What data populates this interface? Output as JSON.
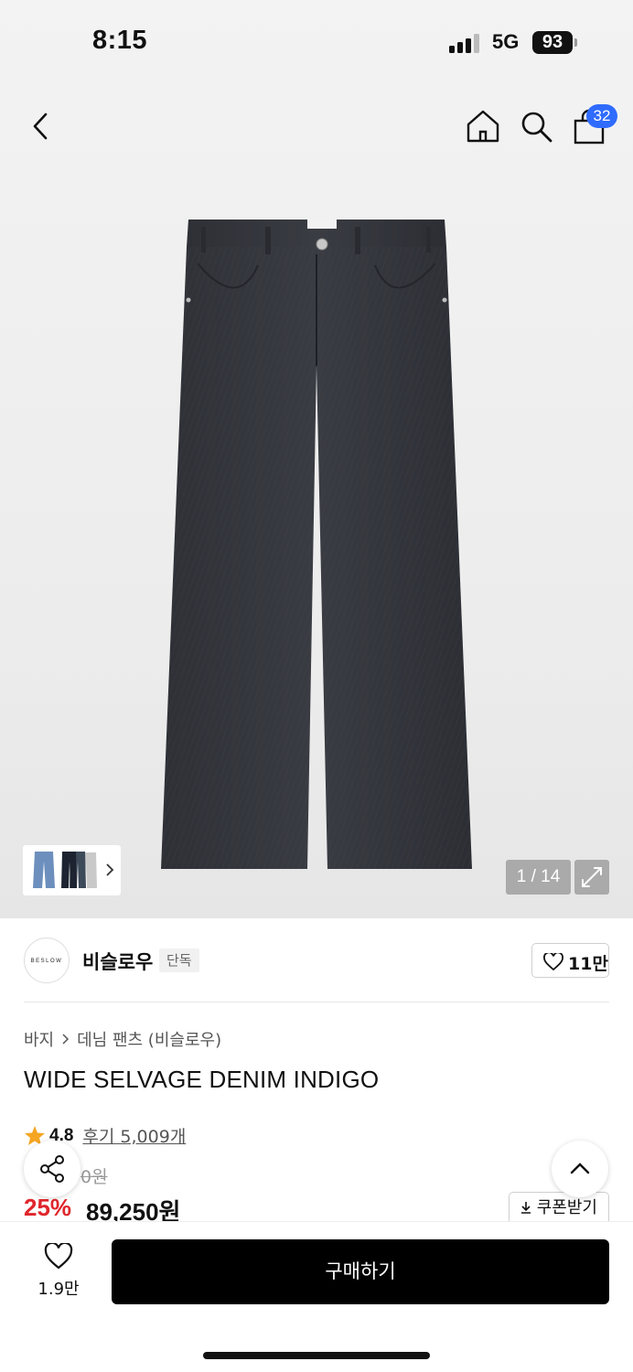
{
  "status_bar": {
    "time": "8:15",
    "network": "5G",
    "battery": "93"
  },
  "nav": {
    "cart_count": "32",
    "icons": [
      "back-icon",
      "home-icon",
      "search-icon",
      "shopping-bag-icon"
    ]
  },
  "gallery": {
    "counter": "1 / 14"
  },
  "brand": {
    "logo_text": "BESLOW",
    "name": "비슬로우",
    "tag": "단독",
    "likes": "11만"
  },
  "breadcrumb": {
    "level1": "바지",
    "level2": "데님 팬츠 (비슬로우)"
  },
  "product": {
    "title": "WIDE SELVAGE DENIM INDIGO",
    "rating": "4.8",
    "reviews": "후기 5,009개",
    "original_price_partial": "0원",
    "discount": "25%",
    "sale_price": "89,250원",
    "coupon_label": "쿠폰받기"
  },
  "bottom": {
    "wish_count": "1.9만",
    "buy_label": "구매하기"
  },
  "colors": {
    "badge": "#2f6bff",
    "discount": "#e0262c",
    "rating_star": "#f5a623",
    "buy_button": "#000000"
  }
}
